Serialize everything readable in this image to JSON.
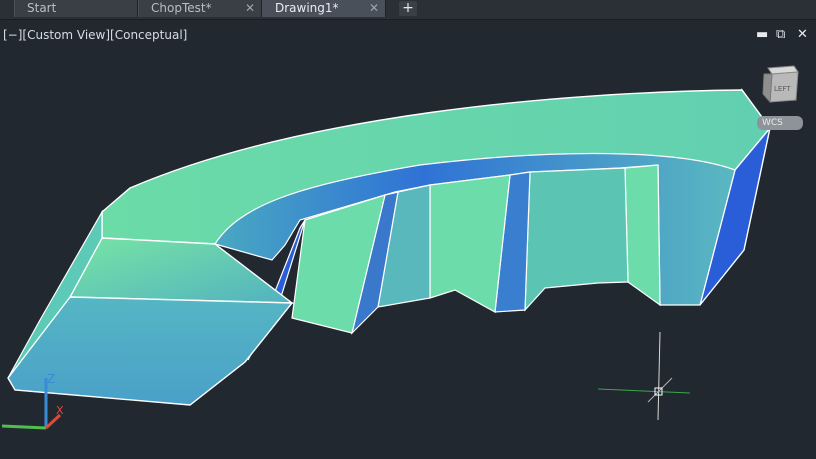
{
  "tabs": [
    {
      "label": "Start",
      "active": false,
      "closable": false
    },
    {
      "label": "ChopTest*",
      "active": false,
      "closable": true
    },
    {
      "label": "Drawing1*",
      "active": true,
      "closable": true
    }
  ],
  "new_tab_label": "+",
  "viewport": {
    "label": "[−][Custom View][Conceptual]",
    "minimize": "▬",
    "restore": "⧉",
    "close": "✕"
  },
  "viewcube": {
    "face_label": "LEFT",
    "wcs_label": "WCS"
  },
  "ucs": {
    "z_label": "Z",
    "x_label": "X"
  },
  "colors": {
    "background": "#212830",
    "model_light": "#6cdcaa",
    "model_mid": "#4ea6c6",
    "model_blue": "#2a5ed8",
    "ucs_z": "#3a8bd6",
    "ucs_x": "#e04a3a",
    "ucs_y": "#4fbf4f"
  }
}
